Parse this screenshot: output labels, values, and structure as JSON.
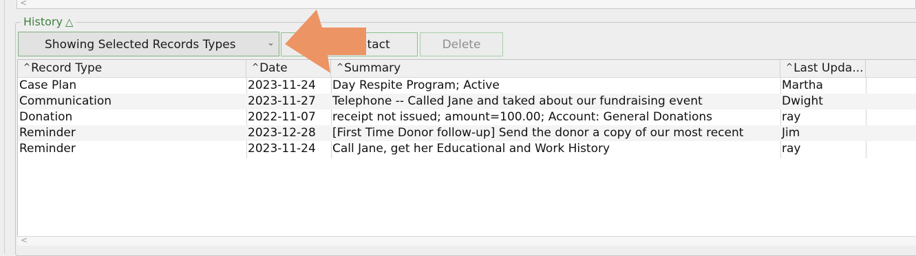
{
  "group": {
    "title": "History",
    "collapse_icon": "triangle-up-icon"
  },
  "toolbar": {
    "filter_label": "Showing Selected Records Types",
    "contact_label": "Contact",
    "contact_visible": "ontact",
    "delete_label": "Delete"
  },
  "table": {
    "sort_glyph": "^",
    "columns": [
      "Record Type",
      "Date",
      "Summary",
      "Last Upda..."
    ],
    "rows": [
      [
        "Case Plan",
        "2023-11-24",
        "Day Respite Program; Active",
        "Martha"
      ],
      [
        "Communication",
        "2023-11-27",
        "Telephone -- Called Jane and taked about our fundraising event",
        "Dwight"
      ],
      [
        "Donation",
        "2022-11-07",
        "receipt not issued; amount=100.00; Account: General Donations",
        "ray"
      ],
      [
        "Reminder",
        "2023-12-28",
        "[First Time Donor follow-up] Send the donor a copy of our most recent",
        "Jim"
      ],
      [
        "Reminder",
        "2023-11-24",
        "Call Jane, get her Educational and Work History",
        "ray"
      ]
    ]
  },
  "colors": {
    "accent_green": "#3f7f3f",
    "annotation_orange": "#ec9463"
  },
  "scroll_arrow": "<"
}
